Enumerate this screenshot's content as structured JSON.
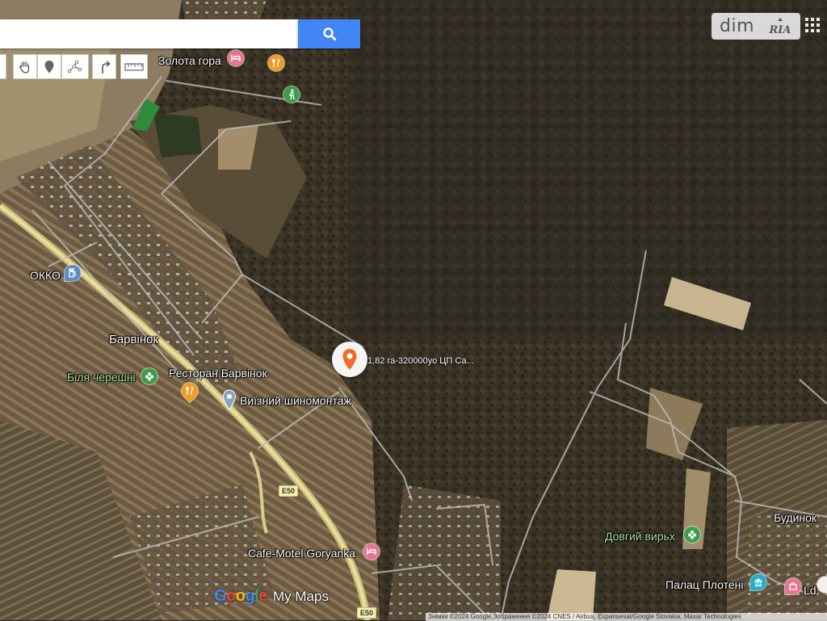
{
  "search": {
    "value": "",
    "placeholder": ""
  },
  "toolbar": {
    "tools": [
      "hand-pan-icon",
      "marker-icon",
      "draw-line-icon",
      "directions-icon",
      "ruler-icon"
    ]
  },
  "branding": {
    "dim": "dim",
    "ria": "RIA"
  },
  "places": {
    "zolota_gora": "Золота гора",
    "okko": "ОККО",
    "barvinok": "Барвінок",
    "bilya_chereshni": "Біля черешні",
    "restoran": "Ресторан Барвінок",
    "shynomontazh": "Виїзний шиномонтаж",
    "cafe_motel": "Cafe-Motel Goryanka",
    "dovhyi_vyrkh": "Довгий вирьх",
    "budynok": "Будинок",
    "palats": "Палац Плотені",
    "ld": "Ld"
  },
  "pin": {
    "label": "1,82 га-320000уо ЦП Са..."
  },
  "roads": {
    "e50_a": "E50",
    "e50_b": "E50"
  },
  "footer": {
    "google": "Google",
    "mymaps": "My Maps",
    "attribution": "Знімки ©2024 Google,Зображення ©2024 CNES / Airbus, Expansesat/Google Slovakia, Maxar Technologies"
  },
  "colors": {
    "search_button": "#4285f4",
    "pin": "#f26d21",
    "poi_food": "#f29b22",
    "poi_park": "#3d9c4a",
    "poi_hotel": "#e57591",
    "poi_blue": "#5e8ac7"
  }
}
